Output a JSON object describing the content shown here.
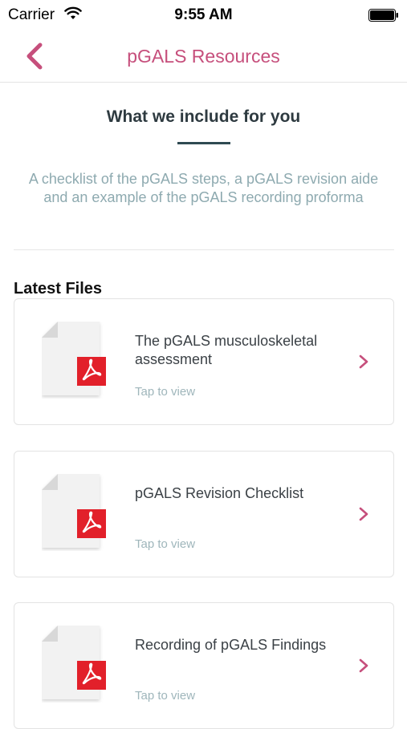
{
  "status_bar": {
    "carrier": "Carrier",
    "time": "9:55 AM"
  },
  "nav": {
    "title": "pGALS Resources",
    "back_icon": "chevron-left-icon"
  },
  "intro": {
    "heading": "What we include for you",
    "description": "A checklist of the pGALS steps, a pGALS revision aide and an example of the pGALS recording proforma"
  },
  "files": {
    "section_title": "Latest Files",
    "items": [
      {
        "title": "The pGALS musculoskeletal assessment",
        "subtitle": "Tap to view",
        "icon": "pdf-file-icon"
      },
      {
        "title": "pGALS Revision Checklist",
        "subtitle": "Tap to view",
        "icon": "pdf-file-icon"
      },
      {
        "title": "Recording of pGALS Findings",
        "subtitle": "Tap to view",
        "icon": "pdf-file-icon"
      }
    ]
  },
  "colors": {
    "accent": "#c64f7c",
    "heading": "#2e3a40",
    "muted": "#8eaab0",
    "pdf_red": "#e2202a"
  }
}
